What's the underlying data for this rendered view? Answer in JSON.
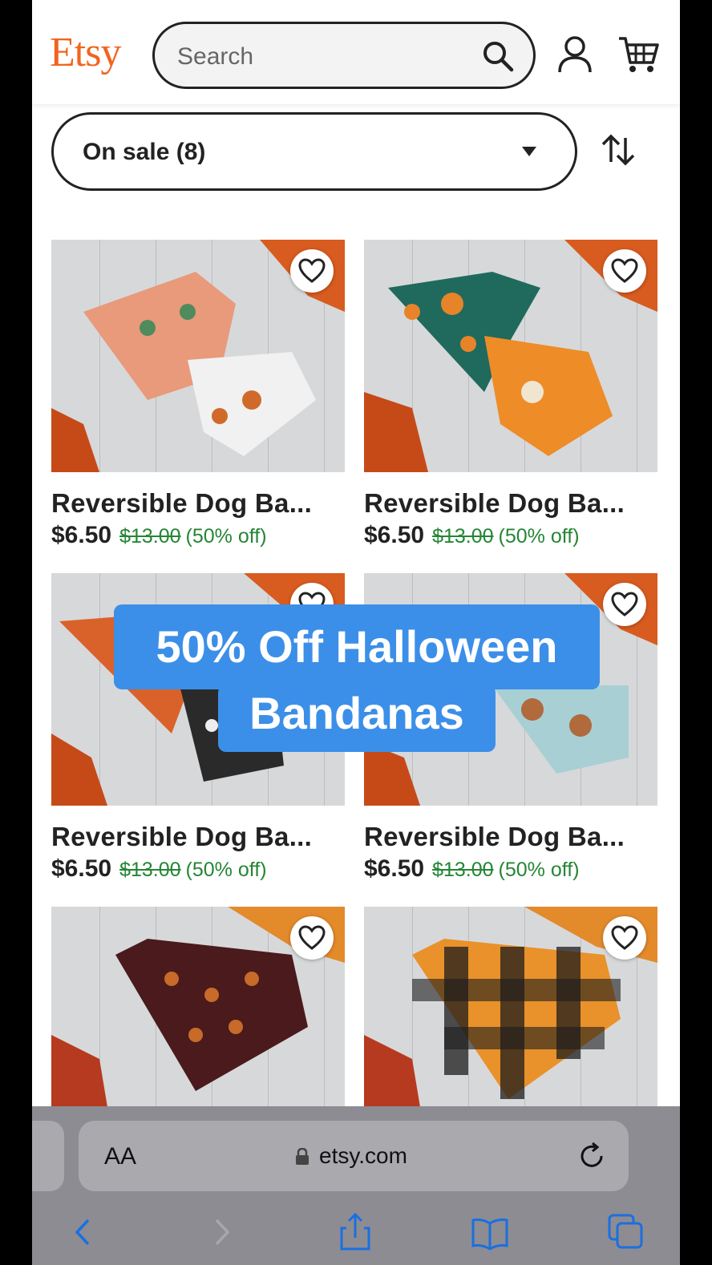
{
  "header": {
    "logo": "Etsy",
    "search_placeholder": "Search"
  },
  "filter": {
    "label": "On sale (8)"
  },
  "products": [
    {
      "title": "Reversible Dog Ba...",
      "price": "$6.50",
      "original_price": "$13.00",
      "discount": "(50% off)"
    },
    {
      "title": "Reversible Dog Ba...",
      "price": "$6.50",
      "original_price": "$13.00",
      "discount": "(50% off)"
    },
    {
      "title": "Reversible Dog Ba...",
      "price": "$6.50",
      "original_price": "$13.00",
      "discount": "(50% off)"
    },
    {
      "title": "Reversible Dog Ba...",
      "price": "$6.50",
      "original_price": "$13.00",
      "discount": "(50% off)"
    },
    {
      "title": "",
      "price": "",
      "original_price": "",
      "discount": ""
    },
    {
      "title": "",
      "price": "",
      "original_price": "",
      "discount": ""
    }
  ],
  "caption": {
    "line1": "50% Off Halloween",
    "line2": "Bandanas"
  },
  "browser": {
    "aa_label": "AA",
    "url": "etsy.com"
  },
  "colors": {
    "brand": "#f1641e",
    "sale_green": "#258635",
    "caption_blue": "#3c8fe8"
  }
}
